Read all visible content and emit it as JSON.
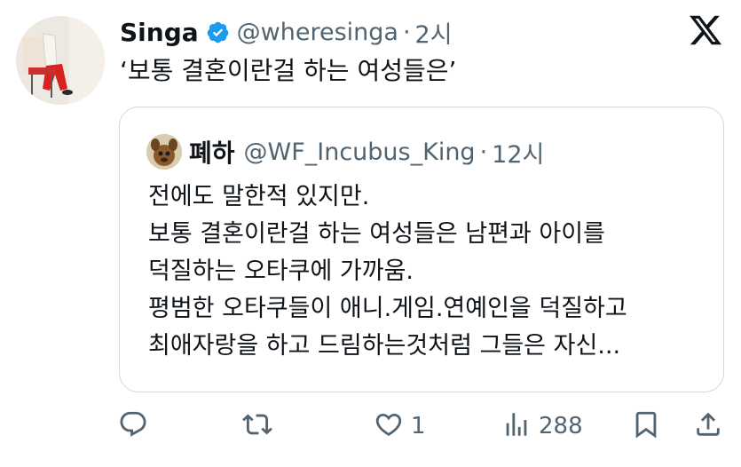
{
  "tweet": {
    "display_name": "Singa",
    "handle": "@wheresinga",
    "separator": "·",
    "time": "2시",
    "text": "‘보통 결혼이란걸 하는 여성들은’"
  },
  "quoted": {
    "display_name": "폐하",
    "handle": "@WF_Incubus_King",
    "separator": "·",
    "time": "12시",
    "lines": [
      "전에도 말한적 있지만.",
      "보통 결혼이란걸 하는 여성들은 남편과 아이를",
      "덕질하는 오타쿠에 가까움.",
      "평범한 오타쿠들이 애니.게임.연예인을 덕질하고",
      "최애자랑을 하고 드림하는것처럼 그들은 자신..."
    ]
  },
  "actions": {
    "reply_icon": "reply-icon",
    "retweet_icon": "retweet-icon",
    "like_icon": "heart-icon",
    "like_count": "1",
    "views_icon": "views-icon",
    "views_count": "288",
    "bookmark_icon": "bookmark-icon",
    "share_icon": "share-icon"
  },
  "colors": {
    "text": "#0f1419",
    "secondary": "#536471",
    "verified": "#1d9bf0",
    "border": "#cfd9de"
  }
}
